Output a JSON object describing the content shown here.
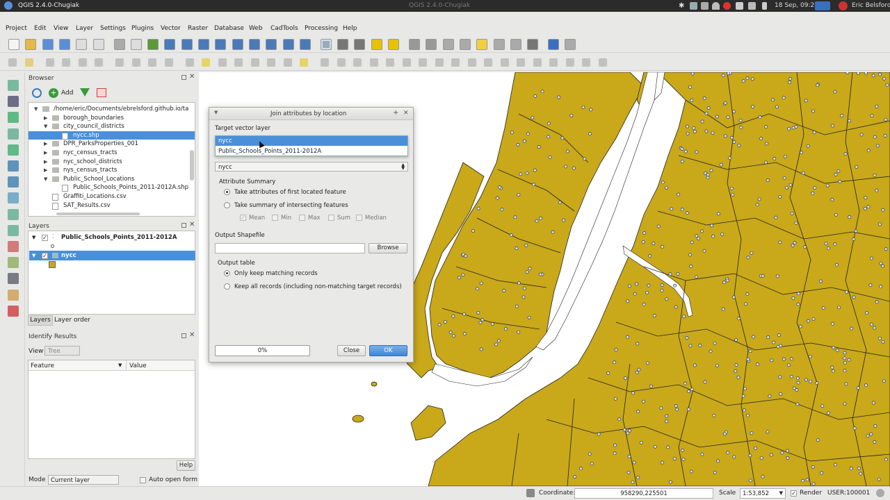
{
  "system": {
    "app_title": "QGIS 2.4.0-Chugiak",
    "center_title": "QGIS 2.4.0-Chugiak",
    "datetime": "18 Sep, 09:29",
    "user": "Eric Belsford"
  },
  "menubar": {
    "items": [
      "Project",
      "Edit",
      "View",
      "Layer",
      "Settings",
      "Plugins",
      "Vector",
      "Raster",
      "Database",
      "Web",
      "CadTools",
      "Processing",
      "Help"
    ]
  },
  "browser": {
    "title": "Browser",
    "add_label": "Add",
    "items": [
      {
        "label": "/home/eric/Documents/ebrelsford.github.io/ta",
        "kind": "folder",
        "expanded": true
      },
      {
        "label": "borough_boundaries",
        "kind": "folder"
      },
      {
        "label": "city_council_districts",
        "kind": "folder",
        "expanded": true
      },
      {
        "label": "nycc.shp",
        "kind": "file",
        "selected": true
      },
      {
        "label": "DPR_ParksProperties_001",
        "kind": "folder"
      },
      {
        "label": "nyc_census_tracts",
        "kind": "folder"
      },
      {
        "label": "nyc_school_districts",
        "kind": "folder"
      },
      {
        "label": "nys_census_tracts",
        "kind": "folder"
      },
      {
        "label": "Public_School_Locations",
        "kind": "folder",
        "expanded": true
      },
      {
        "label": "Public_Schools_Points_2011-2012A.shp",
        "kind": "file"
      },
      {
        "label": "Graffiti_Locations.csv",
        "kind": "file"
      },
      {
        "label": "SAT_Results.csv",
        "kind": "file"
      }
    ]
  },
  "layers": {
    "title": "Layers",
    "items": [
      {
        "label": "Public_Schools_Points_2011-2012A",
        "checked": true
      },
      {
        "label": "nycc",
        "checked": true,
        "selected": true
      }
    ],
    "tabs": [
      "Layers",
      "Layer order"
    ],
    "fill_color": "#c9a81a"
  },
  "identify": {
    "title": "Identify Results",
    "view_label": "View",
    "view_value": "Tree",
    "col_feature": "Feature",
    "col_value": "Value",
    "help_label": "Help",
    "mode_label": "Mode",
    "mode_value": "Current layer",
    "auto_open_label": "Auto open form"
  },
  "dialog": {
    "title": "Join attributes by location",
    "target_label": "Target vector layer",
    "target_value": "nycc",
    "dropdown_options": [
      "nycc",
      "Public_Schools_Points_2011-2012A"
    ],
    "join_value": "nycc",
    "attr_summary_label": "Attribute Summary",
    "radio_first": "Take attributes of first located feature",
    "radio_summary": "Take summary of intersecting features",
    "stats": [
      "Mean",
      "Min",
      "Max",
      "Sum",
      "Median"
    ],
    "output_shapefile_label": "Output Shapefile",
    "output_shapefile_value": "",
    "browse_label": "Browse",
    "output_table_label": "Output table",
    "radio_keep_matching": "Only keep matching records",
    "radio_keep_all": "Keep all records (including non-matching target records)",
    "progress_text": "0%",
    "progress": 0,
    "close_label": "Close",
    "ok_label": "OK"
  },
  "statusbar": {
    "coord_label": "Coordinate:",
    "coord_value": "958290,225501",
    "scale_label": "Scale",
    "scale_value": "1:53,852",
    "render_label": "Render",
    "crs_label": "USER:100001"
  },
  "colors": {
    "land": "#c9a81a",
    "water": "#ffffff",
    "selection": "#4a90d9"
  }
}
